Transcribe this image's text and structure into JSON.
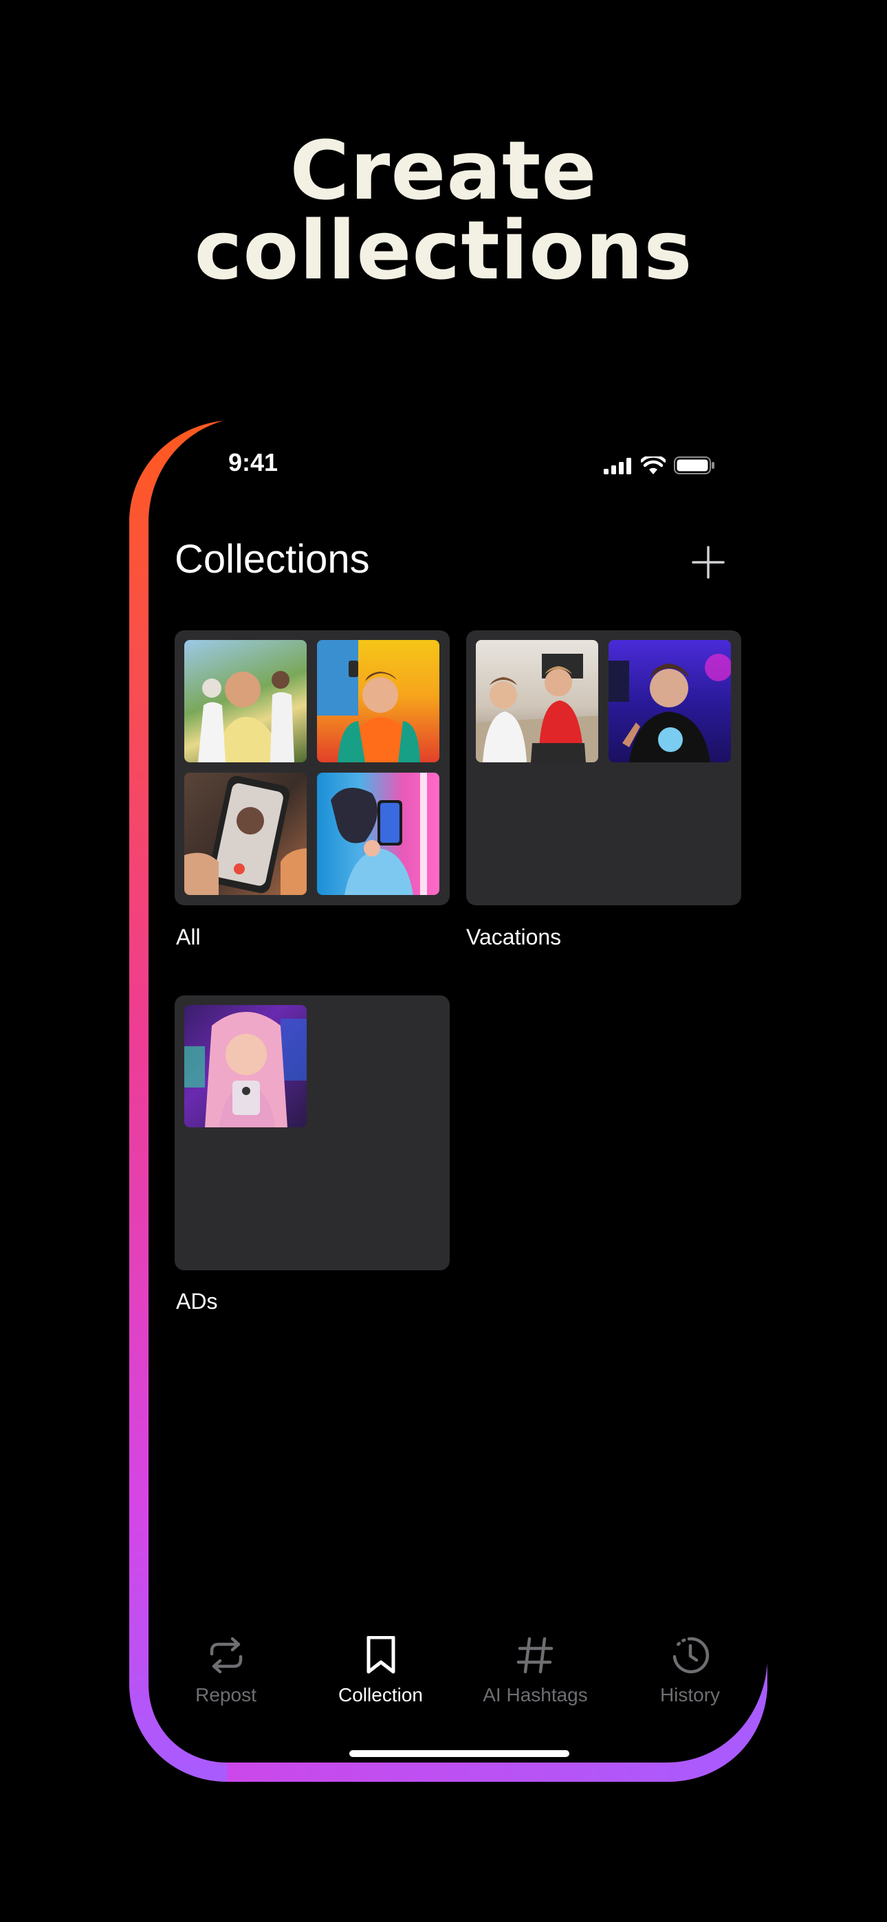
{
  "promo": {
    "headline_line1": "Create",
    "headline_line2": "collections"
  },
  "status_bar": {
    "time": "9:41",
    "icons": [
      "cellular-signal-icon",
      "wifi-icon",
      "battery-icon"
    ]
  },
  "header": {
    "title": "Collections",
    "add_icon": "plus-icon"
  },
  "collections": [
    {
      "name": "All",
      "thumbnails": 4
    },
    {
      "name": "Vacations",
      "thumbnails": 2
    },
    {
      "name": "ADs",
      "thumbnails": 1
    }
  ],
  "tab_bar": {
    "tabs": [
      {
        "label": "Repost",
        "icon": "repost-icon",
        "active": false
      },
      {
        "label": "Collection",
        "icon": "bookmark-icon",
        "active": true
      },
      {
        "label": "AI Hashtags",
        "icon": "hashtag-icon",
        "active": false
      },
      {
        "label": "History",
        "icon": "history-icon",
        "active": false
      }
    ]
  },
  "colors": {
    "background": "#000000",
    "headline": "#f3f1e4",
    "card": "#2c2c2e",
    "tab_inactive": "#6e6e73",
    "tab_active": "#ffffff",
    "frame_gradient_top": "#ff5a1f",
    "frame_gradient_bottom": "#a85cff"
  }
}
